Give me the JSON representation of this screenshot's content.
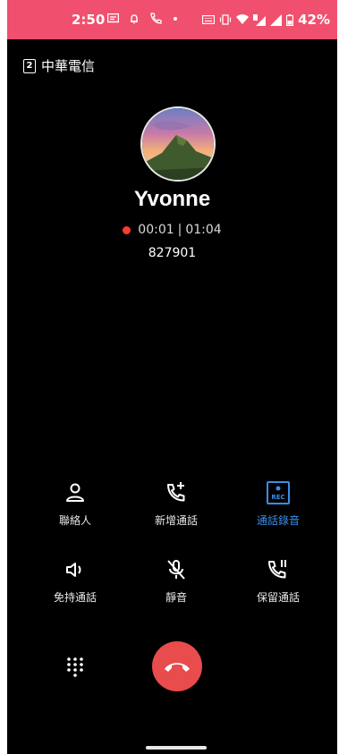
{
  "status_bar": {
    "time": "2:50",
    "battery": "42%"
  },
  "carrier": {
    "sim_slot": "2",
    "name": "中華電信"
  },
  "caller": {
    "name": "Yvonne",
    "record_time": "00:01",
    "separator": "|",
    "call_time": "01:04",
    "number": "827901"
  },
  "controls": {
    "contacts": "聯絡人",
    "add_call": "新增通話",
    "record": "通話錄音",
    "speaker": "免持通話",
    "mute": "靜音",
    "hold": "保留通話"
  },
  "icons": {
    "rec_badge": "REC"
  },
  "colors": {
    "status_bar": "#f0506e",
    "end_call": "#e84c4c",
    "active": "#3a8ee6",
    "record_dot": "#ff3b30"
  }
}
